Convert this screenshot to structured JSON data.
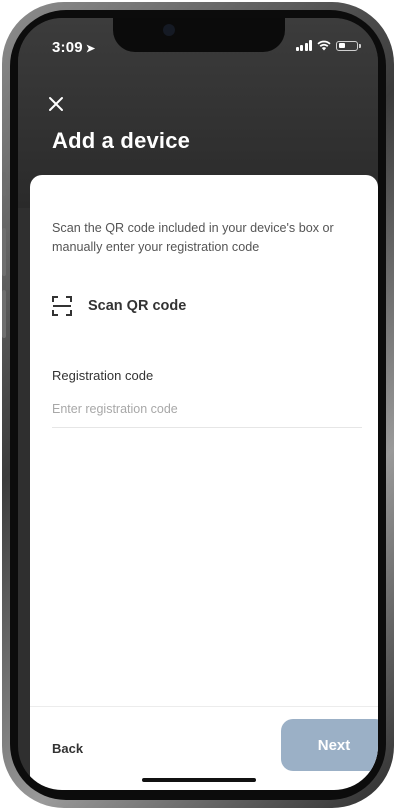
{
  "status_bar": {
    "time": "3:09",
    "location_icon": "location-arrow-icon",
    "icons": [
      "signal-icon",
      "wifi-icon",
      "battery-icon"
    ]
  },
  "header": {
    "close_icon": "close-icon",
    "title": "Add a device"
  },
  "content": {
    "intro_text": "Scan the QR code included in your device's box or manually enter your registration code",
    "scan": {
      "icon": "qr-scan-icon",
      "label": "Scan QR code"
    },
    "registration": {
      "label": "Registration code",
      "value": "",
      "placeholder": "Enter registration code"
    }
  },
  "footer": {
    "back_label": "Back",
    "next_label": "Next"
  },
  "colors": {
    "header_bg": "#2f2f2f",
    "sheet_bg": "#ffffff",
    "next_button_bg": "#9bb0c6",
    "text_primary": "#333333",
    "text_secondary": "#555555",
    "placeholder": "#a8a8a8"
  }
}
